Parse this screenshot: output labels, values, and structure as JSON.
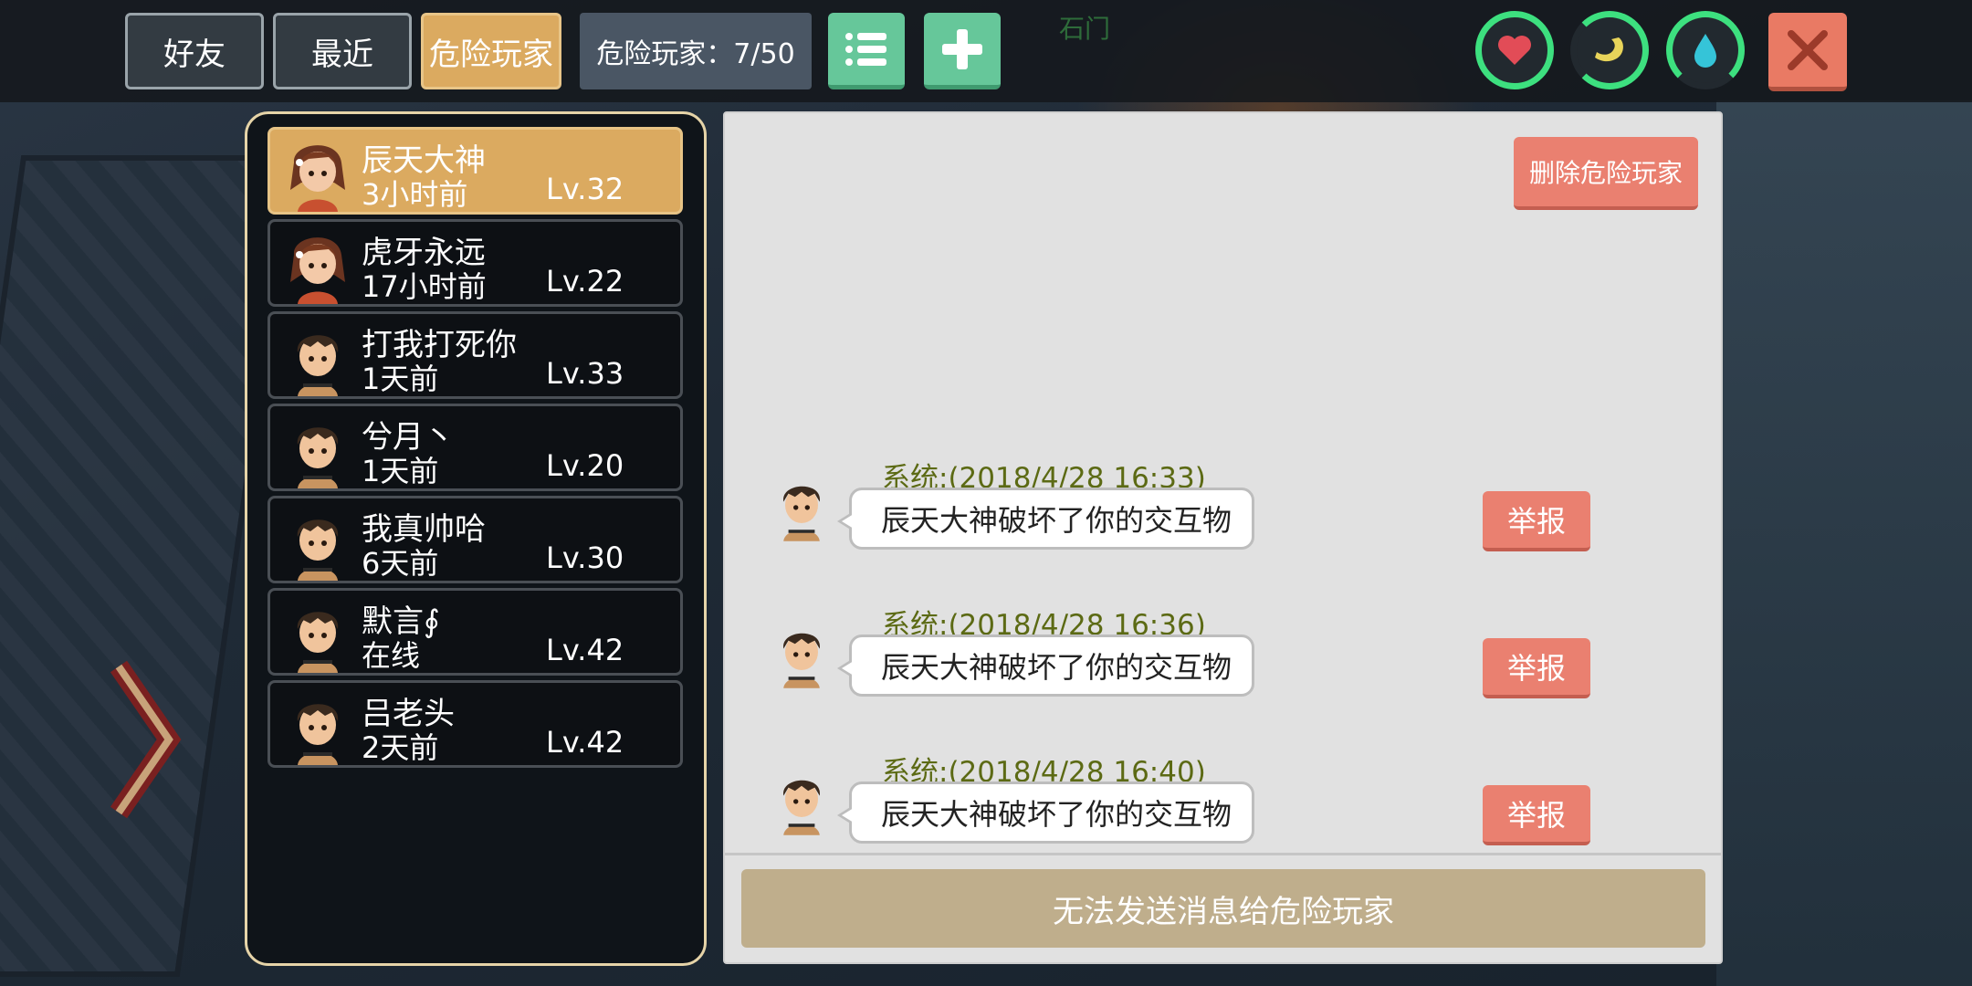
{
  "colors": {
    "accent_gold": "#dbaa60",
    "accent_green": "#66c79a",
    "danger_red": "#ea8070",
    "ring_green": "#3de07f",
    "system_text": "#5c6a14"
  },
  "top_bar": {
    "tabs": [
      {
        "label": "好友",
        "active": false
      },
      {
        "label": "最近",
        "active": false
      },
      {
        "label": "危险玩家",
        "active": true
      }
    ],
    "counter_label": "危险玩家：7/50",
    "list_icon": "list-icon",
    "add_icon": "plus-icon",
    "map_label": "石门",
    "stats": [
      "heart-icon",
      "stomach-icon",
      "water-drop-icon"
    ],
    "close_icon": "close-icon"
  },
  "players": [
    {
      "name": "辰天大神",
      "time": "3小时前",
      "level": "Lv.32",
      "avatar": "female-avatar",
      "selected": true
    },
    {
      "name": "虎牙永远",
      "time": "17小时前",
      "level": "Lv.22",
      "avatar": "female-avatar",
      "selected": false
    },
    {
      "name": "打我打死你",
      "time": "1天前",
      "level": "Lv.33",
      "avatar": "male-avatar",
      "selected": false
    },
    {
      "name": "兮月丶",
      "time": "1天前",
      "level": "Lv.20",
      "avatar": "male-avatar",
      "selected": false
    },
    {
      "name": "我真帅哈",
      "time": "6天前",
      "level": "Lv.30",
      "avatar": "male-avatar",
      "selected": false
    },
    {
      "name": "默言∮",
      "time": "在线",
      "level": "Lv.42",
      "avatar": "male-avatar",
      "selected": false
    },
    {
      "name": "吕老头",
      "time": "2天前",
      "level": "Lv.42",
      "avatar": "male-avatar",
      "selected": false
    }
  ],
  "messages_panel": {
    "delete_label": "删除危险玩家",
    "messages": [
      {
        "sender": "系统:",
        "timestamp": "(2018/4/28 16:33)",
        "text": "辰天大神破坏了你的交互物",
        "report_label": "举报"
      },
      {
        "sender": "系统:",
        "timestamp": "(2018/4/28 16:36)",
        "text": "辰天大神破坏了你的交互物",
        "report_label": "举报"
      },
      {
        "sender": "系统:",
        "timestamp": "(2018/4/28 16:40)",
        "text": "辰天大神破坏了你的交互物",
        "report_label": "举报"
      }
    ],
    "send_disabled_label": "无法发送消息给危险玩家"
  }
}
